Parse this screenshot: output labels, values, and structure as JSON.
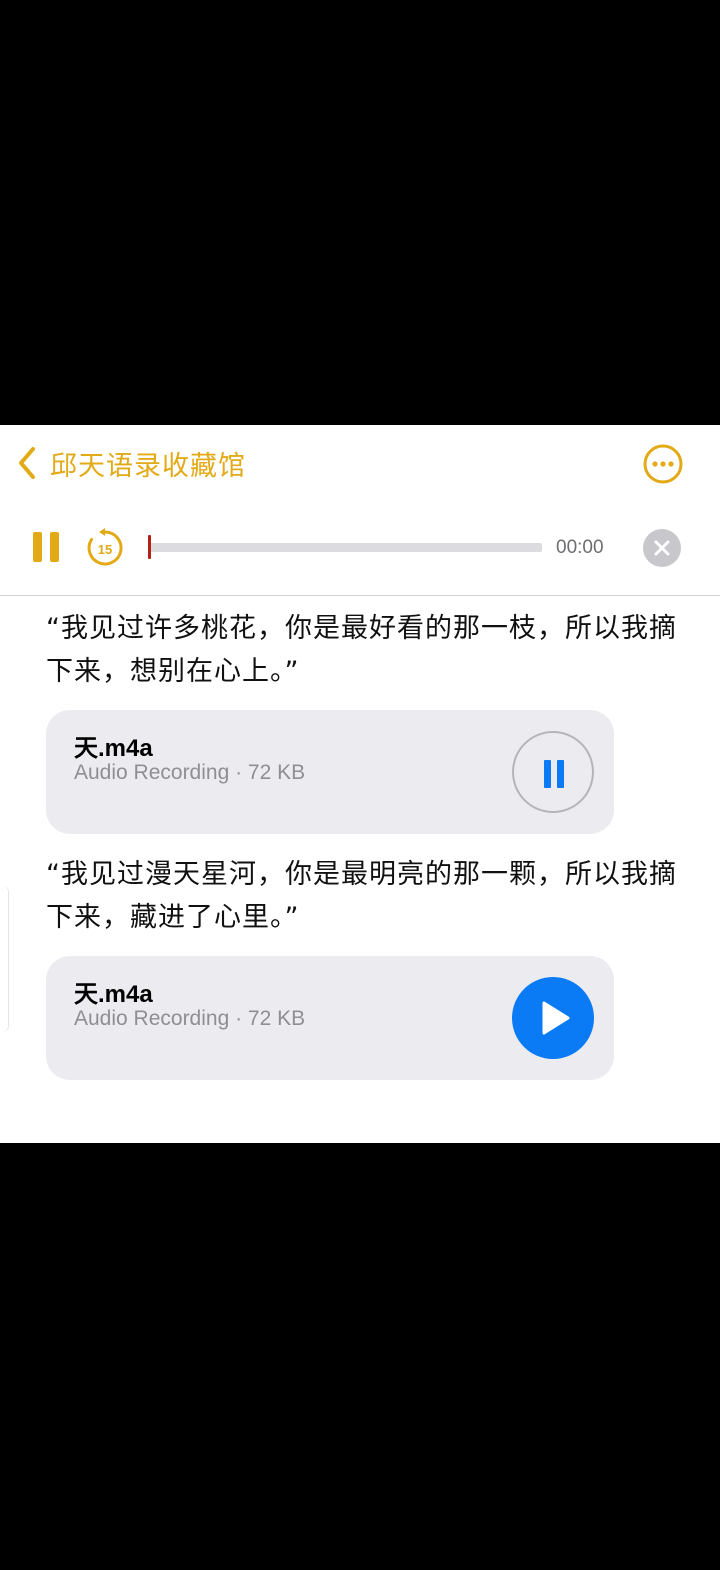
{
  "navbar": {
    "back_label": "邱天语录收藏馆",
    "back_icon": "chevron-left-icon",
    "more_icon": "ellipsis-circle-icon"
  },
  "player": {
    "pause_icon": "pause-icon",
    "skip_back_label": "15",
    "skip_icon": "skip-back-15-icon",
    "progress": 0.0,
    "time": "00:00",
    "close_icon": "close-icon"
  },
  "entries": [
    {
      "quote": "“我见过许多桃花，你是最好看的那一枝，所以我摘下来，想别在心上。”",
      "file_name": "天.m4a",
      "file_sub": "Audio Recording · 72 KB",
      "button_state": "pause"
    },
    {
      "quote": "“我见过漫天星河，你是最明亮的那一颗，所以我摘下来，藏进了心里。”",
      "file_name": "天.m4a",
      "file_sub": "Audio Recording · 72 KB",
      "button_state": "play"
    }
  ],
  "colors": {
    "accent": "#e3aa18",
    "play_blue": "#0a7bf5",
    "card_bg": "#ececf0",
    "secondary_text": "#8e8e93",
    "playhead": "#b32018"
  }
}
